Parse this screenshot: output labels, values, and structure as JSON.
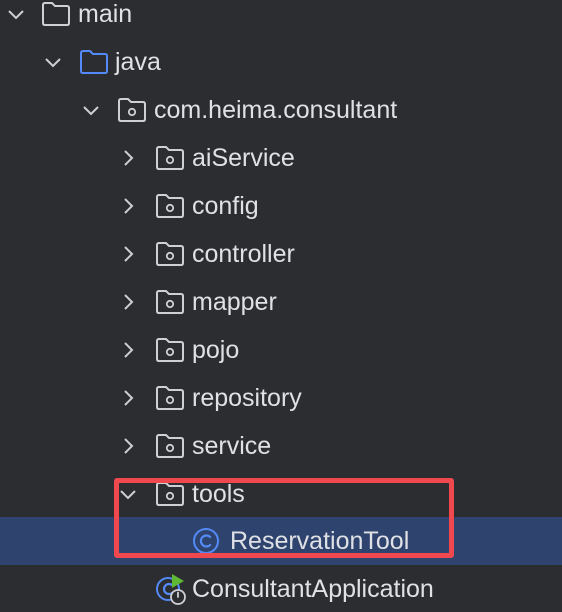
{
  "project_tree": {
    "items": [
      {
        "label": "main",
        "icon": "folder-icon",
        "expanded": true
      },
      {
        "label": "java",
        "icon": "source-folder-icon",
        "expanded": true
      },
      {
        "label": "com.heima.consultant",
        "icon": "package-icon",
        "expanded": true
      },
      {
        "label": "aiService",
        "icon": "package-icon",
        "expanded": false
      },
      {
        "label": "config",
        "icon": "package-icon",
        "expanded": false
      },
      {
        "label": "controller",
        "icon": "package-icon",
        "expanded": false
      },
      {
        "label": "mapper",
        "icon": "package-icon",
        "expanded": false
      },
      {
        "label": "pojo",
        "icon": "package-icon",
        "expanded": false
      },
      {
        "label": "repository",
        "icon": "package-icon",
        "expanded": false
      },
      {
        "label": "service",
        "icon": "package-icon",
        "expanded": false
      },
      {
        "label": "tools",
        "icon": "package-icon",
        "expanded": true
      },
      {
        "label": "ReservationTool",
        "icon": "java-class-icon",
        "selected": true
      },
      {
        "label": "ConsultantApplication",
        "icon": "spring-boot-run-class-icon"
      }
    ]
  },
  "colors": {
    "background": "#2b2d30",
    "selection": "#2e436e",
    "text": "#dfe1e5",
    "highlight_border": "#f0484f",
    "class_icon": "#548af7",
    "spring_icon": "#5fb832"
  }
}
